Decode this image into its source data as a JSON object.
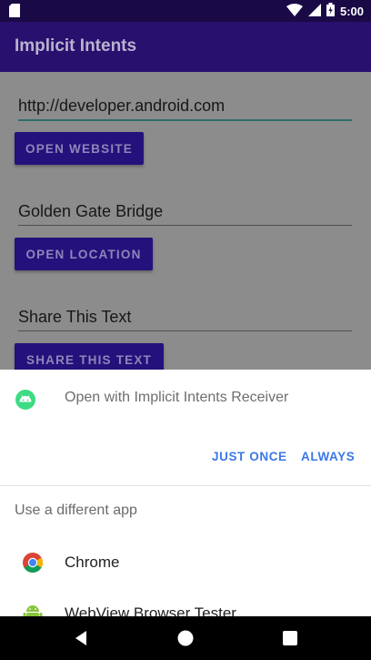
{
  "status_bar": {
    "time": "5:00"
  },
  "app_bar": {
    "title": "Implicit Intents"
  },
  "main": {
    "website_field": {
      "value": "http://developer.android.com"
    },
    "open_website_button": "OPEN WEBSITE",
    "location_field": {
      "value": "Golden Gate Bridge"
    },
    "open_location_button": "OPEN LOCATION",
    "share_field": {
      "value": "Share This Text"
    },
    "share_button": "SHARE THIS TEXT"
  },
  "chooser": {
    "open_with_text": "Open with Implicit Intents Receiver",
    "just_once_label": "JUST ONCE",
    "always_label": "ALWAYS",
    "different_app_label": "Use a different app",
    "apps": [
      {
        "label": "Chrome",
        "icon": "chrome-icon"
      },
      {
        "label": "WebView Browser Tester",
        "icon": "android-app-icon"
      }
    ]
  },
  "colors": {
    "app_bar": "#28106e",
    "status_bar": "#190a46",
    "accent": "#3b78e7",
    "button": "#25117c"
  }
}
